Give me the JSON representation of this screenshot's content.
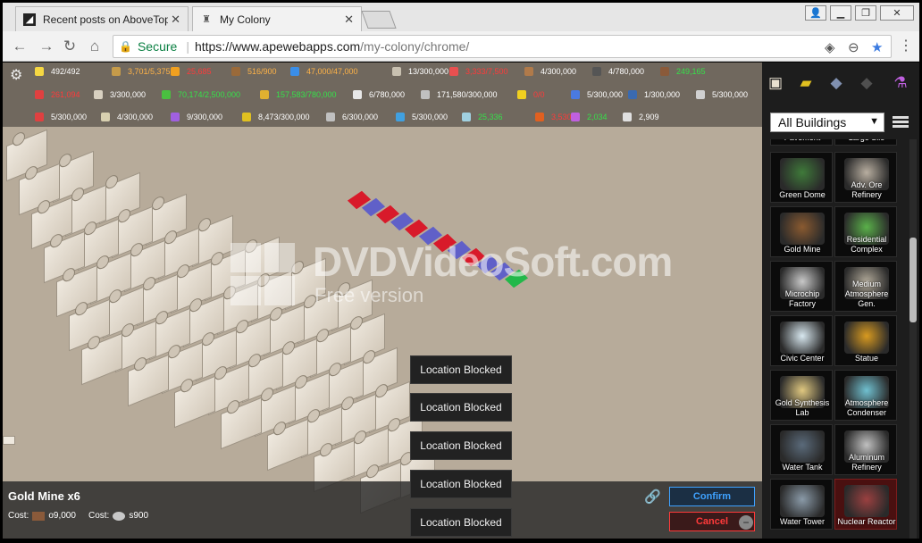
{
  "browser": {
    "tabs": [
      {
        "title": "Recent posts on AboveTop",
        "active": false
      },
      {
        "title": "My Colony",
        "active": true
      }
    ],
    "secure_label": "Secure",
    "url_base": "https://www.apewebapps.com",
    "url_path": "/my-colony/chrome/"
  },
  "resources": {
    "row1": [
      {
        "icon": "bulb-icon",
        "value": "492/492",
        "tone": "w",
        "color": "#f5d742"
      },
      {
        "icon": "hammer-icon",
        "value": "3,701/5,375",
        "tone": "o",
        "color": "#c59b4a"
      },
      {
        "icon": "coin-icon",
        "value": "25,685",
        "tone": "r",
        "color": "#f0a020"
      },
      {
        "icon": "wood-icon",
        "value": "516/900",
        "tone": "o",
        "color": "#9a6a3a"
      },
      {
        "icon": "water-icon",
        "value": "47,000/47,000",
        "tone": "o",
        "color": "#3a8ee8"
      },
      {
        "icon": "ore-icon",
        "value": "13/300,000",
        "tone": "w",
        "color": "#c8c0b0"
      },
      {
        "icon": "food-icon",
        "value": "3,333/7,500",
        "tone": "r",
        "color": "#e85050"
      },
      {
        "icon": "crate-icon",
        "value": "4/300,000",
        "tone": "w",
        "color": "#b07a4a"
      },
      {
        "icon": "metal-icon",
        "value": "4/780,000",
        "tone": "w",
        "color": "#555555"
      },
      {
        "icon": "brick-icon",
        "value": "249,165",
        "tone": "g",
        "color": "#8a5a3a"
      }
    ],
    "row2": [
      {
        "icon": "gem-icon",
        "value": "261,094",
        "tone": "r",
        "color": "#e04040"
      },
      {
        "icon": "steel-icon",
        "value": "3/300,000",
        "tone": "w",
        "color": "#d8d0c0"
      },
      {
        "icon": "plant-icon",
        "value": "70,174/2,500,000",
        "tone": "g",
        "color": "#4ac040"
      },
      {
        "icon": "gold-icon",
        "value": "157,583/780,000",
        "tone": "g",
        "color": "#e0b030"
      },
      {
        "icon": "battery-icon",
        "value": "6/780,000",
        "tone": "w",
        "color": "#e8e8e8"
      },
      {
        "icon": "chip-icon",
        "value": "171,580/300,000",
        "tone": "w",
        "color": "#c0c0c0"
      },
      {
        "icon": "radiation-icon",
        "value": "0/0",
        "tone": "r",
        "color": "#f0d020"
      },
      {
        "icon": "glass-icon",
        "value": "5/300,000",
        "tone": "w",
        "color": "#4a7ae0"
      },
      {
        "icon": "alien-icon",
        "value": "1/300,000",
        "tone": "w",
        "color": "#3a6ab0"
      },
      {
        "icon": "rock-icon",
        "value": "5/300,000",
        "tone": "w",
        "color": "#d0d0d0"
      }
    ],
    "row3": [
      {
        "icon": "star-icon",
        "value": "5/300,000",
        "tone": "w",
        "color": "#e04040"
      },
      {
        "icon": "oil-icon",
        "value": "4/300,000",
        "tone": "w",
        "color": "#d8d0b0"
      },
      {
        "icon": "rainbow-icon",
        "value": "9/300,000",
        "tone": "w",
        "color": "#a060e0"
      },
      {
        "icon": "book-icon",
        "value": "8,473/300,000",
        "tone": "w",
        "color": "#e0c020"
      },
      {
        "icon": "robot-icon",
        "value": "6/300,000",
        "tone": "w",
        "color": "#c0c0c0"
      },
      {
        "icon": "ring-icon",
        "value": "5/300,000",
        "tone": "w",
        "color": "#40a0e0"
      },
      {
        "icon": "people-icon",
        "value": "25,336",
        "tone": "g",
        "color": "#a0d0e0"
      },
      {
        "icon": "fire-icon",
        "value": "3,530",
        "tone": "r",
        "color": "#e06020"
      },
      {
        "icon": "flask-icon",
        "value": "2,034",
        "tone": "g",
        "color": "#c060e0"
      },
      {
        "icon": "bank-icon",
        "value": "2,909",
        "tone": "w",
        "color": "#e0e0e0"
      }
    ]
  },
  "watermark": {
    "title": "DVDVideoSoft.com",
    "subtitle": "Free version"
  },
  "toasts": [
    "Location Blocked",
    "Location Blocked",
    "Location Blocked",
    "Location Blocked",
    "Location Blocked"
  ],
  "selection": {
    "title": "Gold Mine x6",
    "cost_label": "Cost:",
    "cost1": "o9,000",
    "cost2": "s900",
    "confirm": "Confirm",
    "cancel": "Cancel"
  },
  "panel": {
    "filter": "All Buildings",
    "top_partial": [
      "Pavement",
      "Large Silo"
    ],
    "buildings": [
      {
        "name": "Green Dome",
        "color": "#3f7a3a"
      },
      {
        "name": "Adv. Ore Refinery",
        "color": "#b8aea0"
      },
      {
        "name": "Gold Mine",
        "color": "#8a5a30"
      },
      {
        "name": "Residential Complex",
        "color": "#5ab04a"
      },
      {
        "name": "Microchip Factory",
        "color": "#c8c8c8"
      },
      {
        "name": "Medium Atmosphere Gen.",
        "color": "#b0a898"
      },
      {
        "name": "Civic Center",
        "color": "#d8e8f0"
      },
      {
        "name": "Statue",
        "color": "#d89a20"
      },
      {
        "name": "Gold Synthesis Lab",
        "color": "#e0c880"
      },
      {
        "name": "Atmosphere Condenser",
        "color": "#70c0d0"
      },
      {
        "name": "Water Tank",
        "color": "#5a6a7a"
      },
      {
        "name": "Aluminum Refinery",
        "color": "#c0c0c0"
      },
      {
        "name": "Water Tower",
        "color": "#8a9aa8"
      },
      {
        "name": "Nuclear Reactor",
        "color": "#9a4040"
      }
    ]
  }
}
